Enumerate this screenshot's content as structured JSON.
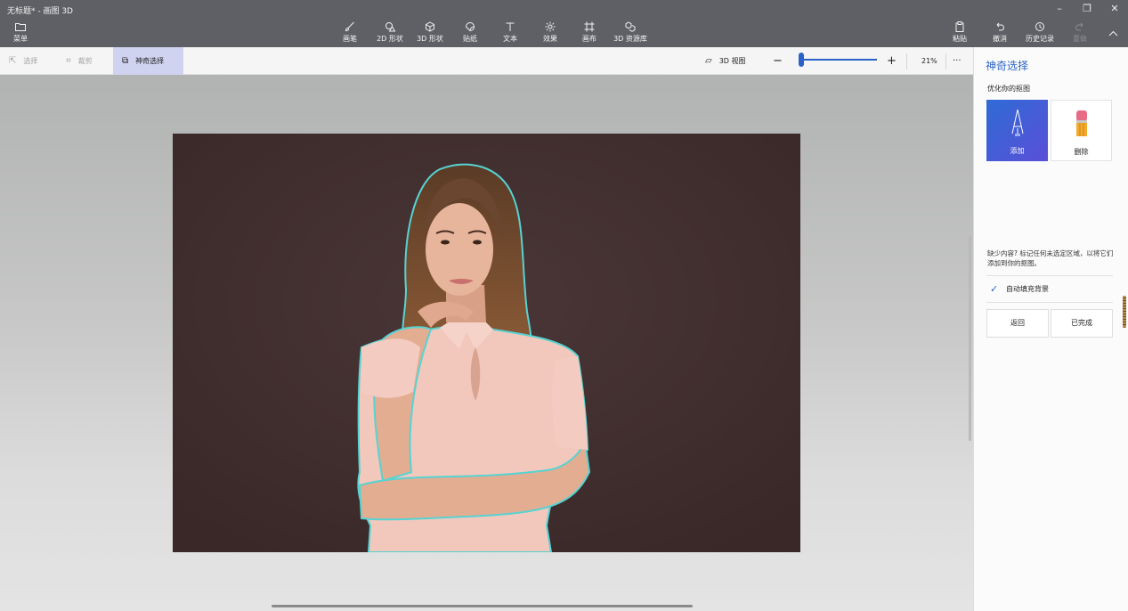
{
  "window": {
    "title": "无标题* - 画图 3D",
    "controls": {
      "minimize": "–",
      "maximize": "❐",
      "close": "✕"
    }
  },
  "toolbar": {
    "menu": "菜单",
    "tools": [
      {
        "label": "画笔",
        "icon": "brush-icon"
      },
      {
        "label": "2D 形状",
        "icon": "2d-shapes-icon"
      },
      {
        "label": "3D 形状",
        "icon": "3d-shapes-icon"
      },
      {
        "label": "贴纸",
        "icon": "stickers-icon"
      },
      {
        "label": "文本",
        "icon": "text-icon"
      },
      {
        "label": "效果",
        "icon": "effects-icon"
      },
      {
        "label": "画布",
        "icon": "canvas-icon"
      },
      {
        "label": "3D 资源库",
        "icon": "3d-library-icon"
      }
    ],
    "paste": "粘贴",
    "undo": "撤消",
    "history": "历史记录",
    "redo": "重做"
  },
  "subbar": {
    "select": "选择",
    "crop": "裁剪",
    "magic_select": "神奇选择",
    "view_3d": "3D 视图",
    "zoom": "21%",
    "zoom_level": 0.05,
    "more": "···"
  },
  "panel": {
    "title": "神奇选择",
    "subtitle": "优化你的抠图",
    "add_label": "添加",
    "remove_label": "删除",
    "hint": "缺少内容? 标记任何未选定区域，以将它们添加到你的抠图。",
    "autofill_label": "自动填充背景",
    "autofill_checked": true,
    "back_label": "返回",
    "done_label": "已完成"
  },
  "colors": {
    "toolbar_bg": "#5f6066",
    "accent": "#2c64c8",
    "photo_bg": "#3f2d2e",
    "selection_outline": "#57d3d2"
  }
}
